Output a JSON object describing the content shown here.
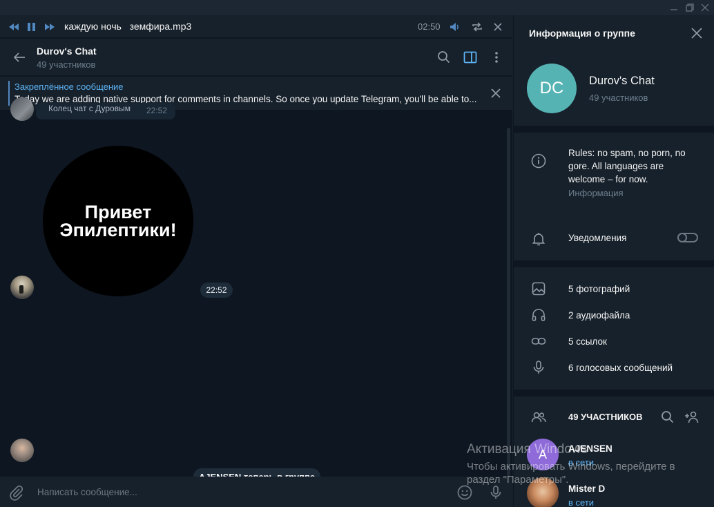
{
  "window": {
    "minimize_icon": "minimize-icon",
    "restore_icon": "restore-icon",
    "close_icon": "close-icon"
  },
  "player": {
    "track": "каждую ночь   земфира.mp3",
    "time": "02:50"
  },
  "chat": {
    "title": "Durov's Chat",
    "subtitle": "49 участников"
  },
  "pinned": {
    "title": "Закреплённое сообщение",
    "text": "Today we are adding native support for comments in channels. So once you update Telegram, you'll be able to..."
  },
  "messages": {
    "old_bubble_text": "Колец чат с Дуровым",
    "old_bubble_time": "22:52",
    "video_text": "Привет\nЭпилептики!",
    "video_time": "22:52",
    "service": "AJENSEN теперь в группе"
  },
  "composer": {
    "placeholder": "Написать сообщение..."
  },
  "panel": {
    "title": "Информация о группе",
    "avatar_initials": "DC",
    "avatar_color": "#56b3b4",
    "name": "Durov's Chat",
    "members_count": "49 участников",
    "rules": "Rules: no spam, no porn, no gore. All languages are welcome – for now.",
    "rules_label": "Информация",
    "notifications_label": "Уведомления",
    "notifications_on": false,
    "media": [
      {
        "icon": "photo-icon",
        "label": "5 фотографий"
      },
      {
        "icon": "headphones-icon",
        "label": "2 аудиофайла"
      },
      {
        "icon": "link-icon",
        "label": "5 ссылок"
      },
      {
        "icon": "microphone-icon",
        "label": "6 голосовых сообщений"
      }
    ],
    "members_title": "49 УЧАСТНИКОВ",
    "members": [
      {
        "initial": "A",
        "color": "#8e6bd8",
        "name": "AJENSEN",
        "status": "в сети"
      },
      {
        "initial": "",
        "color": "#a06a48",
        "name": "Mister D",
        "status": "в сети"
      }
    ]
  },
  "watermark": {
    "line1": "Активация Windows",
    "line2": "Чтобы активировать Windows, перейдите в",
    "line3": "раздел \"Параметры\"."
  }
}
